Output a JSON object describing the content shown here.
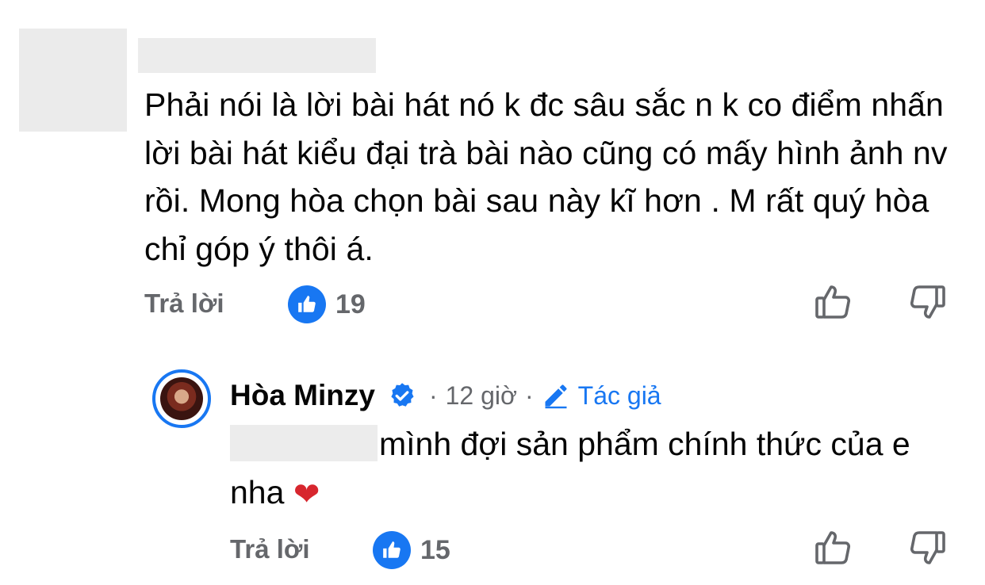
{
  "comment": {
    "text": "Phải nói là lời bài hát nó k đc sâu sắc n k co điểm nhấn lời bài hát kiểu đại trà bài nào cũng có mấy hình ảnh nv rồi. Mong hòa  chọn bài sau  này  kĩ hơn .  M rất quý hòa chỉ góp ý  thôi á.",
    "reply_label": "Trả lời",
    "like_count": "19"
  },
  "reply": {
    "author": "Hòa Minzy",
    "separator1": "·",
    "time": "12 giờ",
    "separator2": "·",
    "author_tag": "Tác giả",
    "text": "mình đợi sản phẩm chính thức của e nha",
    "reply_label": "Trả lời",
    "like_count": "15"
  },
  "colors": {
    "accent": "#1877f2",
    "muted": "#65676b",
    "heart": "#d7262e"
  },
  "icons": [
    "like-badge-icon",
    "thumbs-up-outline-icon",
    "thumbs-down-outline-icon",
    "verified-badge-icon",
    "pencil-icon",
    "heart-icon"
  ]
}
